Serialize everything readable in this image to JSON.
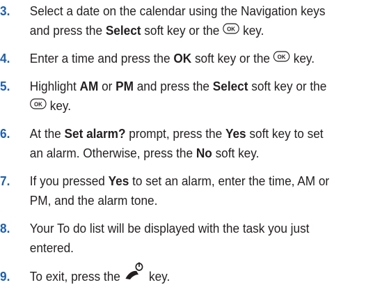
{
  "steps": [
    {
      "num": "3.",
      "l1a": "Select a date on the calendar using the Navigation keys",
      "l2a": "and press the ",
      "l2b": "Select",
      "l2c": " soft key or the ",
      "l2d": " key."
    },
    {
      "num": "4.",
      "a": "Enter a time and press the ",
      "b": "OK",
      "c": " soft key or the ",
      "d": " key."
    },
    {
      "num": "5.",
      "a": "Highlight ",
      "b": "AM",
      "c": " or ",
      "d": "PM",
      "e": " and press the ",
      "f": "Select",
      "g": " soft key or the",
      "l2": " key."
    },
    {
      "num": "6.",
      "a": "At the ",
      "b": "Set alarm?",
      "c": " prompt, press the ",
      "d": "Yes",
      "e": " soft key to set",
      "f": "an alarm. Otherwise, press the ",
      "g": "No",
      "h": " soft key."
    },
    {
      "num": "7.",
      "a": "If you pressed ",
      "b": "Yes",
      "c": " to set an alarm, enter the time, AM or",
      "d": "PM, and the alarm tone."
    },
    {
      "num": "8.",
      "a": "Your To do list will be displayed with the task you just",
      "b": "entered."
    },
    {
      "num": "9.",
      "a": "To exit, press the ",
      "b": " key."
    }
  ],
  "keys": {
    "ok_label": "OK",
    "ok_icon": "ok-key-icon",
    "end_icon": "end-power-key-icon"
  }
}
